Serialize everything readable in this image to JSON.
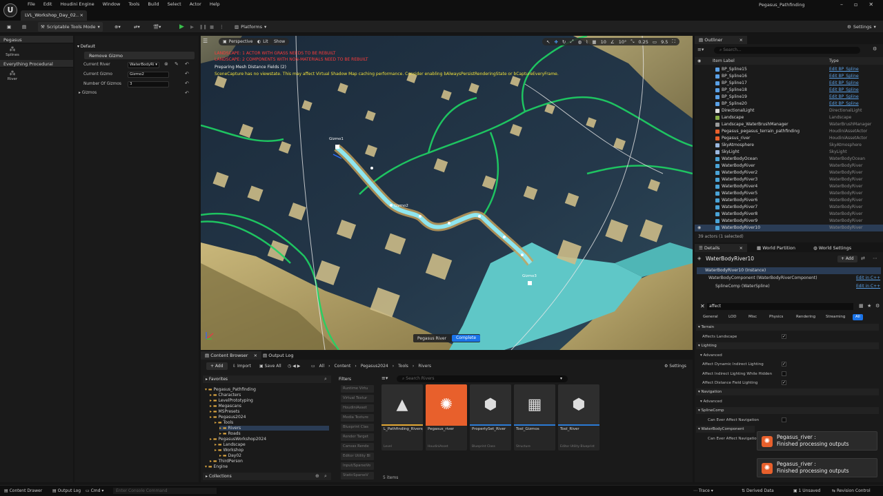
{
  "titlebar": {
    "menu": [
      "File",
      "Edit",
      "Houdini Engine",
      "Window",
      "Tools",
      "Build",
      "Select",
      "Actor",
      "Help"
    ],
    "level_tab": "LVL_Workshop_Day_02..",
    "project": "Pegasus_Pathfinding"
  },
  "toolbar": {
    "mode": "Scriptable Tools Mode",
    "platforms": "Platforms",
    "settings": "Settings"
  },
  "palette": {
    "group1": "Pegasus",
    "tool1": "Splines",
    "group2": "Everything Procedural",
    "tool2": "River"
  },
  "tooldetails": {
    "section": "Default",
    "remove_button": "Remove Gizmo",
    "current_river_label": "Current River",
    "current_river_value": "WaterBodyRi",
    "current_gizmo_label": "Current Gizmo",
    "current_gizmo_value": "Gizmo2",
    "num_gizmos_label": "Number Of Gizmos",
    "num_gizmos_value": "3",
    "gizmos_label": "Gizmos"
  },
  "viewport": {
    "perspective": "Perspective",
    "lit": "Lit",
    "show": "Show",
    "warnings": [
      "LANDSCAPE: 1 ACTOR WITH GRASS NEEDS TO BE REBUILT",
      "LANDSCAPE: 2 COMPONENTS WITH NON-MATERIALS NEED TO BE REBUILT",
      "Preparing Mesh Distance Fields (2)",
      "SceneCapture has no viewstate. This may affect Virtual Shadow Map caching performance. Consider enabling bAlwaysPersistRenderingState or bCaptureEveryFrame."
    ],
    "readouts": [
      "10",
      "10°",
      "0.25",
      "9.5"
    ],
    "gizmo1": "Gizmo1",
    "gizmo2": "Gizmo2",
    "gizmo3": "Gizmo3",
    "status_label": "Pegasus River",
    "status_value": "Complete"
  },
  "outliner": {
    "tab": "Outliner",
    "search_placeholder": "Search...",
    "col_label": "Item Label",
    "col_type": "Type",
    "rows": [
      {
        "name": "BP_Spline15",
        "type": "Edit BP_Spline",
        "link": true
      },
      {
        "name": "BP_Spline16",
        "type": "Edit BP_Spline",
        "link": true
      },
      {
        "name": "BP_Spline17",
        "type": "Edit BP_Spline",
        "link": true
      },
      {
        "name": "BP_Spline18",
        "type": "Edit BP_Spline",
        "link": true
      },
      {
        "name": "BP_Spline19",
        "type": "Edit BP_Spline",
        "link": true
      },
      {
        "name": "BP_Spline20",
        "type": "Edit BP_Spline",
        "link": true
      },
      {
        "name": "DirectionalLight",
        "type": "DirectionalLight",
        "link": false
      },
      {
        "name": "Landscape",
        "type": "Landscape",
        "link": false
      },
      {
        "name": "Landscape_WaterBrushManager",
        "type": "WaterBrushManager",
        "link": false
      },
      {
        "name": "Pegasus_pegasus_terrain_pathfinding",
        "type": "HoudiniAssetActor",
        "link": false
      },
      {
        "name": "Pegasus_river",
        "type": "HoudiniAssetActor",
        "link": false
      },
      {
        "name": "SkyAtmosphere",
        "type": "SkyAtmosphere",
        "link": false
      },
      {
        "name": "SkyLight",
        "type": "SkyLight",
        "link": false
      },
      {
        "name": "WaterBodyOcean",
        "type": "WaterBodyOcean",
        "link": false
      },
      {
        "name": "WaterBodyRiver",
        "type": "WaterBodyRiver",
        "link": false
      },
      {
        "name": "WaterBodyRiver2",
        "type": "WaterBodyRiver",
        "link": false
      },
      {
        "name": "WaterBodyRiver3",
        "type": "WaterBodyRiver",
        "link": false
      },
      {
        "name": "WaterBodyRiver4",
        "type": "WaterBodyRiver",
        "link": false
      },
      {
        "name": "WaterBodyRiver5",
        "type": "WaterBodyRiver",
        "link": false
      },
      {
        "name": "WaterBodyRiver6",
        "type": "WaterBodyRiver",
        "link": false
      },
      {
        "name": "WaterBodyRiver7",
        "type": "WaterBodyRiver",
        "link": false
      },
      {
        "name": "WaterBodyRiver8",
        "type": "WaterBodyRiver",
        "link": false
      },
      {
        "name": "WaterBodyRiver9",
        "type": "WaterBodyRiver",
        "link": false
      },
      {
        "name": "WaterBodyRiver10",
        "type": "WaterBodyRiver",
        "link": false
      }
    ],
    "footer": "39 actors (1 selected)"
  },
  "details": {
    "tab1": "Details",
    "tab2": "World Partition",
    "tab3": "World Settings",
    "actor": "WaterBodyRiver10",
    "add": "+ Add",
    "instance": "WaterBodyRiver10 (Instance)",
    "component1": "WaterBodyComponent (WaterBodyRiverComponent)",
    "component2": "SplineComp (WaterSpline)",
    "edit_cpp": "Edit in C++",
    "search_value": "affect",
    "categories": [
      "General",
      "LOD",
      "Misc",
      "Physics",
      "Rendering",
      "Streaming",
      "All"
    ],
    "sec_terrain": "Terrain",
    "p_affects_landscape": "Affects Landscape",
    "sec_lighting": "Lighting",
    "sec_advanced": "Advanced",
    "p_dyn_indirect": "Affect Dynamic Indirect Lighting",
    "p_indirect_hidden": "Affect Indirect Lighting While Hidden",
    "p_distance_field": "Affect Distance Field Lighting",
    "sec_navigation": "Navigation",
    "sec_advanced2": "Advanced",
    "sec_splinecomp": "SplineComp",
    "p_can_affect_nav": "Can Ever Affect Navigation",
    "sec_waterbody": "WaterBodyComponent",
    "p_can_affect_nav2": "Can Ever Affect Navigation"
  },
  "toasts": [
    {
      "title": "Pegasus_river :",
      "body": "Finished processing outputs"
    },
    {
      "title": "Pegasus_river :",
      "body": "Finished processing outputs"
    }
  ],
  "contentbrowser": {
    "tab1": "Content Browser",
    "tab2": "Output Log",
    "add": "+ Add",
    "import": "Import",
    "save_all": "Save All",
    "crumbs": [
      "All",
      "Content",
      "Pegasus2024",
      "Tools",
      "Rivers"
    ],
    "settings": "Settings",
    "favorites": "Favorites",
    "tree": [
      {
        "label": "Pegasus_Pathfinding",
        "depth": 0
      },
      {
        "label": "Characters",
        "depth": 1
      },
      {
        "label": "LevelPrototyping",
        "depth": 1
      },
      {
        "label": "Megascans",
        "depth": 1
      },
      {
        "label": "MSPresets",
        "depth": 1
      },
      {
        "label": "Pegasus2024",
        "depth": 1
      },
      {
        "label": "Tools",
        "depth": 2
      },
      {
        "label": "Rivers",
        "depth": 3
      },
      {
        "label": "Roads",
        "depth": 3
      },
      {
        "label": "PegasusWorkshop2024",
        "depth": 1
      },
      {
        "label": "Landscape",
        "depth": 2
      },
      {
        "label": "Workshop",
        "depth": 2
      },
      {
        "label": "Day02",
        "depth": 3
      },
      {
        "label": "ThirdPerson",
        "depth": 1
      },
      {
        "label": "Engine",
        "depth": 0
      }
    ],
    "collections": "Collections",
    "filters_label": "Filters",
    "filters": [
      "Runtime Virtu",
      "Virtual Textur",
      "HoudiniAsset",
      "Media Texture",
      "Blueprint Clas",
      "Render Target",
      "Canvas Rende",
      "Editor Utility Bl",
      "Input/SparseVo",
      "StaticSparseV"
    ],
    "search_placeholder": "Search Rivers",
    "assets": [
      {
        "name": "L_Pathfinding_Rivers_Example",
        "type": "Level",
        "color": "#e2a733"
      },
      {
        "name": "Pegasus_river",
        "type": "HoudiniAsset",
        "color": "#e8602c"
      },
      {
        "name": "PropertySet_River",
        "type": "Blueprint Class",
        "color": "#2a7bd6"
      },
      {
        "name": "Tool_Gizmos",
        "type": "Structure",
        "color": "#2a7bd6"
      },
      {
        "name": "Tool_River",
        "type": "Editor Utility Blueprint",
        "color": "#2a7bd6"
      }
    ],
    "count": "5 items"
  },
  "statusbar": {
    "content_drawer": "Content Drawer",
    "output_log": "Output Log",
    "cmd": "Cmd",
    "console_placeholder": "Enter Console Command",
    "trace": "Trace",
    "derived": "Derived Data",
    "unsaved": "1 Unsaved",
    "revision": "Revision Control"
  }
}
